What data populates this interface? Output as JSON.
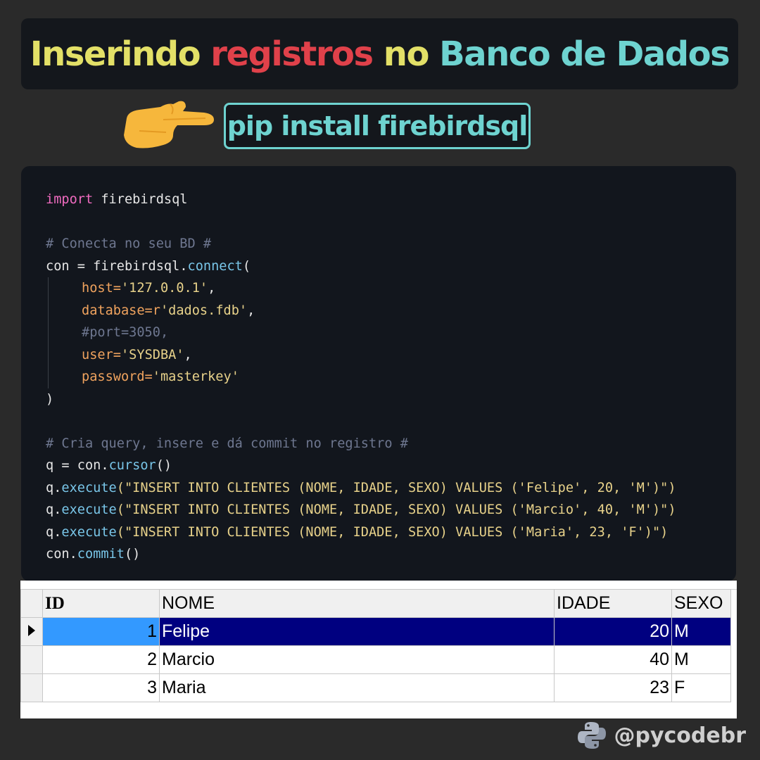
{
  "title": {
    "part1": "Inserindo ",
    "part2": "registros",
    "part3": " no ",
    "part4": "Banco de Dados",
    "colors": {
      "yellow": "#e3e067",
      "red": "#e0414a",
      "cyan": "#6ed3d0"
    }
  },
  "install": {
    "icon": "pointing-hand-icon",
    "command": "pip install firebirdsql"
  },
  "code": {
    "line1_kw": "import",
    "line1_rest": " firebirdsql",
    "comment1": "# Conecta no seu BD #",
    "connect_var": "con",
    "connect_eq": " = firebirdsql.",
    "connect_fn": "connect",
    "connect_paren": "(",
    "host_key": "host=",
    "host_val": "'127.0.0.1'",
    "db_key": "database=r",
    "db_val": "'dados.fdb'",
    "port_comment": "#port=3050,",
    "user_key": "user=",
    "user_val": "'SYSDBA'",
    "pw_key": "password=",
    "pw_val": "'masterkey'",
    "close_paren": ")",
    "comment2": "# Cria query, insere e dá commit no registro #",
    "cursor_pre": "q = con.",
    "cursor_fn": "cursor",
    "cursor_post": "()",
    "exec_pre": "q.",
    "exec_fn": "execute",
    "exec1_arg": "(\"INSERT INTO CLIENTES (NOME, IDADE, SEXO) VALUES ('Felipe', 20, 'M')\")",
    "exec2_arg": "(\"INSERT INTO CLIENTES (NOME, IDADE, SEXO) VALUES ('Marcio', 40, 'M')\")",
    "exec3_arg": "(\"INSERT INTO CLIENTES (NOME, IDADE, SEXO) VALUES ('Maria', 23, 'F')\")",
    "commit_pre": "con.",
    "commit_fn": "commit",
    "commit_post": "()",
    "comma": ","
  },
  "grid": {
    "headers": [
      "ID",
      "NOME",
      "IDADE",
      "SEXO"
    ],
    "rows": [
      {
        "id": "1",
        "nome": "Felipe",
        "idade": "20",
        "sexo": "M",
        "selected": true
      },
      {
        "id": "2",
        "nome": "Marcio",
        "idade": "40",
        "sexo": "M",
        "selected": false
      },
      {
        "id": "3",
        "nome": "Maria",
        "idade": "23",
        "sexo": "F",
        "selected": false
      }
    ],
    "row_indicator_icon": "triangle-right-icon"
  },
  "footer": {
    "icon": "python-logo-icon",
    "handle": "@pycodebr"
  }
}
